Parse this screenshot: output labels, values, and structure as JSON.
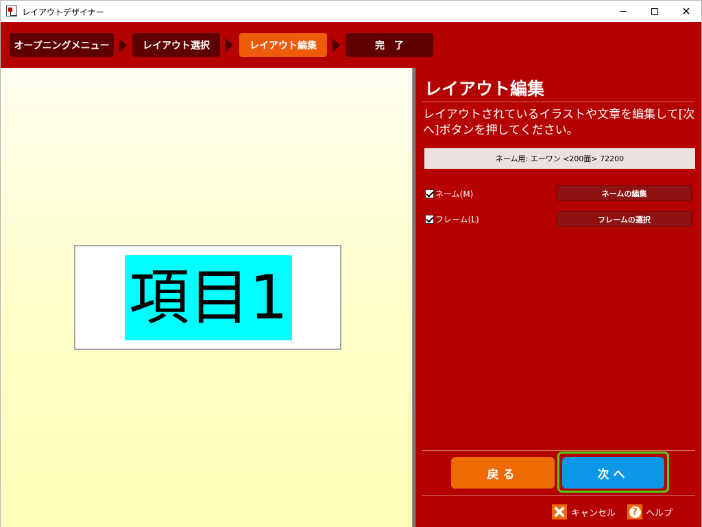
{
  "window": {
    "title": "レイアウトデザイナー",
    "minimize_glyph": "",
    "maximize_glyph": "",
    "close_glyph": "✕"
  },
  "steps": [
    {
      "label": "オープニングメニュー",
      "active": false
    },
    {
      "label": "レイアウト選択",
      "active": false
    },
    {
      "label": "レイアウト編集",
      "active": true
    },
    {
      "label": "完　了",
      "active": false
    }
  ],
  "canvas": {
    "item_text": "項目1"
  },
  "panel": {
    "title": "レイアウト編集",
    "description": "レイアウトされているイラストや文章を編集して[次へ]ボタンを押してください。",
    "info": "ネーム用: エーワン <200面> 72200",
    "options": [
      {
        "label": "ネーム(M)",
        "checked": true,
        "button": "ネームの編集"
      },
      {
        "label": "フレーム(L)",
        "checked": true,
        "button": "フレームの選択"
      }
    ],
    "back_label": "戻る",
    "next_label": "次へ"
  },
  "footer": {
    "cancel_label": "キャンセル",
    "help_label": "ヘルプ",
    "help_glyph": "?"
  },
  "colors": {
    "brand_red": "#b50000",
    "step_dark": "#5f0000",
    "step_active": "#ee5b0a",
    "back_orange": "#ee6a00",
    "next_blue": "#0a98e6",
    "focus_green": "#52d11a",
    "highlight_cyan": "#00ffff"
  }
}
